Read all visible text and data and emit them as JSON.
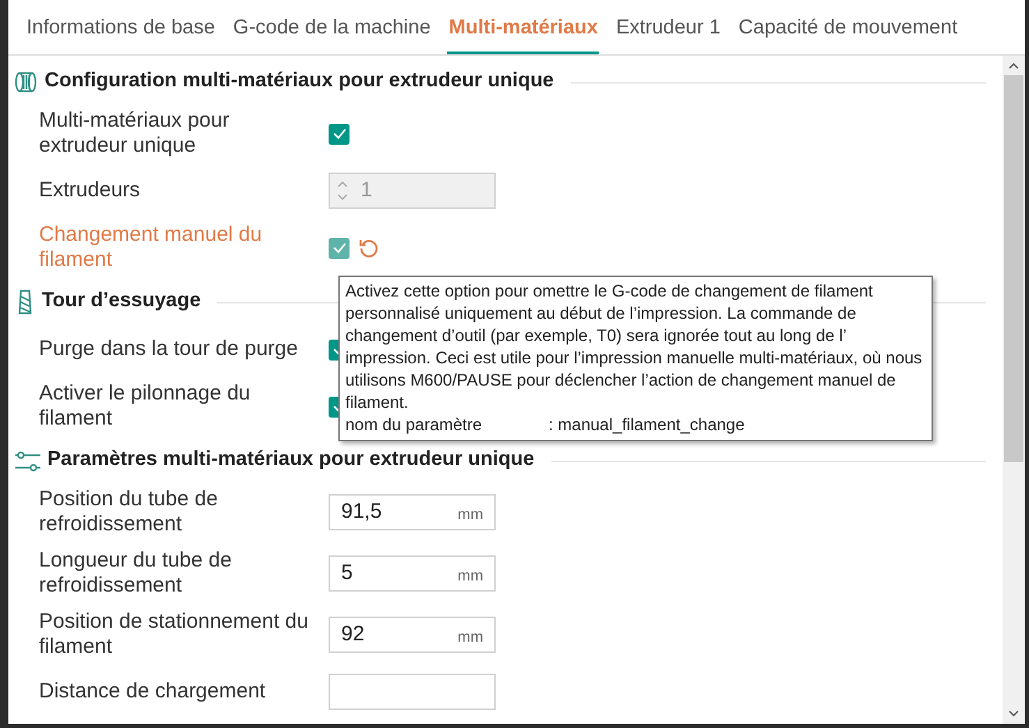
{
  "tabs": [
    {
      "label": "Informations de base",
      "selected": false
    },
    {
      "label": "G-code de la machine",
      "selected": false
    },
    {
      "label": "Multi-matériaux",
      "selected": true
    },
    {
      "label": "Extrudeur 1",
      "selected": false
    },
    {
      "label": "Capacité de mouvement",
      "selected": false
    }
  ],
  "sections": [
    {
      "title": "Configuration multi-matériaux pour extrudeur unique",
      "rows": [
        {
          "kind": "checkbox",
          "label": "Multi-matériaux pour extrudeur unique",
          "checked": true,
          "modified": false
        },
        {
          "kind": "spinner",
          "label": "Extrudeurs",
          "value": "1",
          "disabled": true
        },
        {
          "kind": "checkbox",
          "label": "Changement manuel du filament",
          "checked": true,
          "modified": true
        }
      ]
    },
    {
      "title": "Tour d’essuyage",
      "rows": [
        {
          "kind": "checkbox",
          "label": "Purge dans la tour de purge",
          "checked": true,
          "modified": false
        },
        {
          "kind": "checkbox",
          "label": "Activer le pilonnage du filament",
          "checked": true,
          "modified": false
        }
      ]
    },
    {
      "title": "Paramètres multi-matériaux pour extrudeur unique",
      "rows": [
        {
          "kind": "number",
          "label": "Position du tube de refroidissement",
          "value": "91,5",
          "unit": "mm"
        },
        {
          "kind": "number",
          "label": "Longueur du tube de refroidissement",
          "value": "5",
          "unit": "mm"
        },
        {
          "kind": "number",
          "label": "Position de stationnement du filament",
          "value": "92",
          "unit": "mm"
        },
        {
          "kind": "number",
          "label": "Distance de chargement"
        }
      ]
    }
  ],
  "tooltip": {
    "text": "Activez cette option pour omettre le G-code de changement de filament personnalisé uniquement au début de l’impression. La commande de changement d’outil (par exemple, T0) sera ignorée tout au long de l’ impression. Ceci est utile pour l’impression manuelle multi-matériaux, où nous utilisons M600/PAUSE pour déclencher l’action de changement manuel de filament.",
    "param_label": "nom du paramètre",
    "param_value": ": manual_filament_change"
  }
}
